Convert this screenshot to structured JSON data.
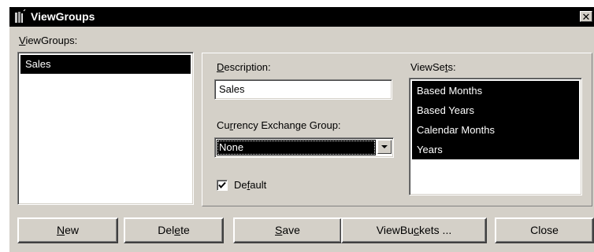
{
  "window": {
    "title": "ViewGroups",
    "close_glyph": "✕"
  },
  "viewgroups_label": {
    "pre": "",
    "key": "V",
    "post": "iewGroups:"
  },
  "viewgroups_list": [
    {
      "label": "Sales"
    }
  ],
  "description": {
    "pre": "",
    "key": "D",
    "post": "escription:",
    "value": "Sales"
  },
  "currency": {
    "pre": "Cu",
    "key": "r",
    "post": "rency Exchange Group:",
    "value": "None"
  },
  "default_check": {
    "pre": "De",
    "key": "f",
    "post": "ault",
    "checked": true
  },
  "viewsets": {
    "pre": "ViewSe",
    "key": "t",
    "post": "s:",
    "items": [
      {
        "label": "Based Months"
      },
      {
        "label": "Based Years"
      },
      {
        "label": "Calendar Months"
      },
      {
        "label": "Years"
      }
    ]
  },
  "buttons": {
    "new": {
      "pre": "",
      "key": "N",
      "post": "ew"
    },
    "delete": {
      "pre": "Del",
      "key": "e",
      "post": "te"
    },
    "save": {
      "pre": "",
      "key": "S",
      "post": "ave"
    },
    "viewbuckets": {
      "pre": "ViewBu",
      "key": "c",
      "post": "kets ..."
    },
    "close": {
      "pre": "",
      "key": "",
      "post": "Close"
    }
  },
  "icons": {
    "app": "bookshelf-icon",
    "close": "close-icon",
    "dropdown": "chevron-down-icon",
    "check": "checkmark-icon"
  }
}
